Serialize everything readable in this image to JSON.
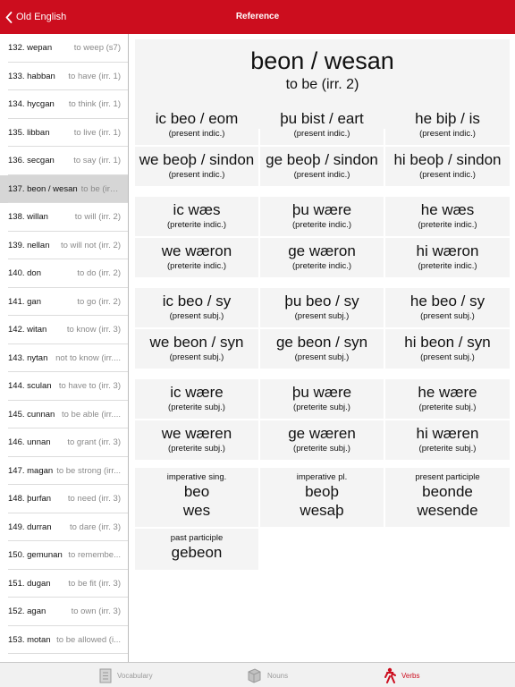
{
  "header": {
    "back_label": "Old English",
    "title": "Reference"
  },
  "sidebar": {
    "items": [
      {
        "word": "132. wepan",
        "meaning": "to weep (s7)"
      },
      {
        "word": "133. habban",
        "meaning": "to have (irr. 1)"
      },
      {
        "word": "134. hycgan",
        "meaning": "to think (irr. 1)"
      },
      {
        "word": "135. libban",
        "meaning": "to live (irr. 1)"
      },
      {
        "word": "136. secgan",
        "meaning": "to say (irr. 1)"
      },
      {
        "word": "137. beon / wesan",
        "meaning": "to be (irr....",
        "selected": true
      },
      {
        "word": "138. willan",
        "meaning": "to will (irr. 2)"
      },
      {
        "word": "139. nellan",
        "meaning": "to will not (irr. 2)"
      },
      {
        "word": "140. don",
        "meaning": "to do (irr. 2)"
      },
      {
        "word": "141. gan",
        "meaning": "to go (irr. 2)"
      },
      {
        "word": "142. witan",
        "meaning": "to know (irr. 3)"
      },
      {
        "word": "143. nytan",
        "meaning": "not to know (irr...."
      },
      {
        "word": "144. sculan",
        "meaning": "to have to (irr. 3)"
      },
      {
        "word": "145. cunnan",
        "meaning": "to be able (irr...."
      },
      {
        "word": "146. unnan",
        "meaning": "to grant (irr. 3)"
      },
      {
        "word": "147. magan",
        "meaning": "to be strong (irr..."
      },
      {
        "word": "148. þurfan",
        "meaning": "to need (irr. 3)"
      },
      {
        "word": "149. durran",
        "meaning": "to dare (irr. 3)"
      },
      {
        "word": "150. gemunan",
        "meaning": "to remembe..."
      },
      {
        "word": "151. dugan",
        "meaning": "to be fit (irr. 3)"
      },
      {
        "word": "152. agan",
        "meaning": "to own (irr. 3)"
      },
      {
        "word": "153. motan",
        "meaning": "to be allowed (i..."
      }
    ]
  },
  "main": {
    "verb_title": "beon / wesan",
    "verb_subtitle": "to be (irr. 2)",
    "conjugation_blocks": [
      {
        "rows": [
          [
            {
              "form": "ic beo / eom",
              "note": "(present indic.)"
            },
            {
              "form": "þu bist / eart",
              "note": "(present indic.)"
            },
            {
              "form": "he biþ / is",
              "note": "(present indic.)"
            }
          ],
          [
            {
              "form": "we beoþ / sindon",
              "note": "(present indic.)"
            },
            {
              "form": "ge beoþ / sindon",
              "note": "(present indic.)"
            },
            {
              "form": "hi beoþ / sindon",
              "note": "(present indic.)"
            }
          ]
        ]
      },
      {
        "rows": [
          [
            {
              "form": "ic wæs",
              "note": "(preterite indic.)"
            },
            {
              "form": "þu wære",
              "note": "(preterite indic.)"
            },
            {
              "form": "he wæs",
              "note": "(preterite indic.)"
            }
          ],
          [
            {
              "form": "we wæron",
              "note": "(preterite indic.)"
            },
            {
              "form": "ge wæron",
              "note": "(preterite indic.)"
            },
            {
              "form": "hi wæron",
              "note": "(preterite indic.)"
            }
          ]
        ]
      },
      {
        "rows": [
          [
            {
              "form": "ic beo / sy",
              "note": "(present subj.)"
            },
            {
              "form": "þu beo / sy",
              "note": "(present subj.)"
            },
            {
              "form": "he beo / sy",
              "note": "(present subj.)"
            }
          ],
          [
            {
              "form": "we beon / syn",
              "note": "(present subj.)"
            },
            {
              "form": "ge beon / syn",
              "note": "(present subj.)"
            },
            {
              "form": "hi beon / syn",
              "note": "(present subj.)"
            }
          ]
        ]
      },
      {
        "rows": [
          [
            {
              "form": "ic wære",
              "note": "(preterite subj.)"
            },
            {
              "form": "þu wære",
              "note": "(preterite subj.)"
            },
            {
              "form": "he wære",
              "note": "(preterite subj.)"
            }
          ],
          [
            {
              "form": "we wæren",
              "note": "(preterite subj.)"
            },
            {
              "form": "ge wæren",
              "note": "(preterite subj.)"
            },
            {
              "form": "hi wæren",
              "note": "(preterite subj.)"
            }
          ]
        ]
      }
    ],
    "other_forms": [
      {
        "label": "imperative sing.",
        "forms": [
          "beo",
          "wes"
        ]
      },
      {
        "label": "imperative pl.",
        "forms": [
          "beoþ",
          "wesaþ"
        ]
      },
      {
        "label": "present participle",
        "forms": [
          "beonde",
          "wesende"
        ]
      },
      {
        "label": "past participle",
        "forms": [
          "gebeon"
        ]
      }
    ]
  },
  "tabbar": {
    "tabs": [
      {
        "label": "Vocabulary",
        "icon": "vocabulary-icon"
      },
      {
        "label": "Nouns",
        "icon": "nouns-icon"
      },
      {
        "label": "Verbs",
        "icon": "verbs-icon",
        "active": true
      }
    ]
  },
  "colors": {
    "accent": "#cc0d1e",
    "cell_bg": "#f4f4f4",
    "selected_bg": "#d6d6d6",
    "tab_inactive": "#9a9a9a"
  }
}
